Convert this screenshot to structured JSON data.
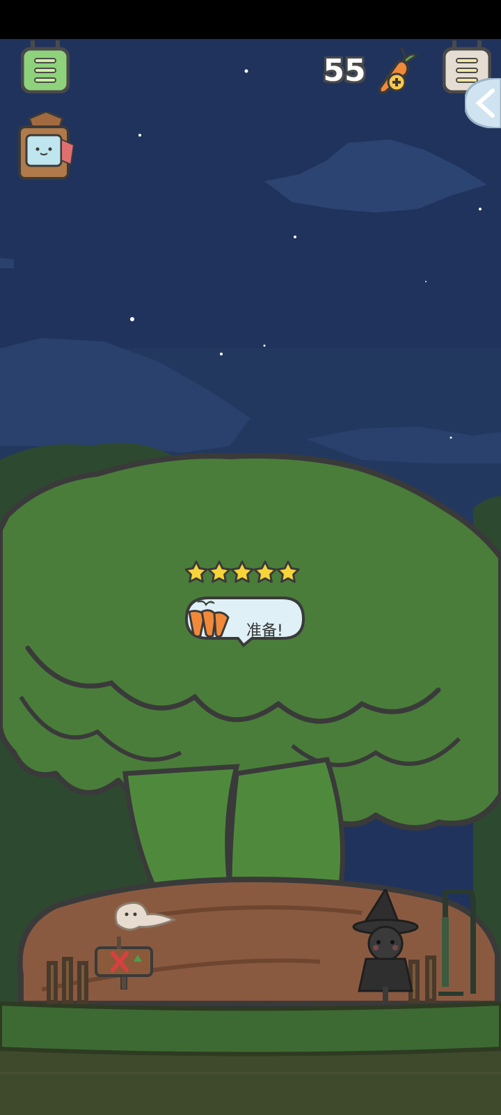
{
  "hud": {
    "carrot_count": "55",
    "left_menu_icon": "menu-icon",
    "right_menu_icon": "menu-icon",
    "carrot_add_icon": "carrot-plus-icon",
    "shop_icon": "treasure-lantern-icon",
    "side_collapse_icon": "chevron-left-icon"
  },
  "field": {
    "stars": 5,
    "speech_text": "准备!",
    "speech_icon": "carrots-icon"
  },
  "colors": {
    "sky": "#20335c",
    "tree": "#477b39",
    "ground": "#3d6a33",
    "mound": "#8a5a40"
  }
}
